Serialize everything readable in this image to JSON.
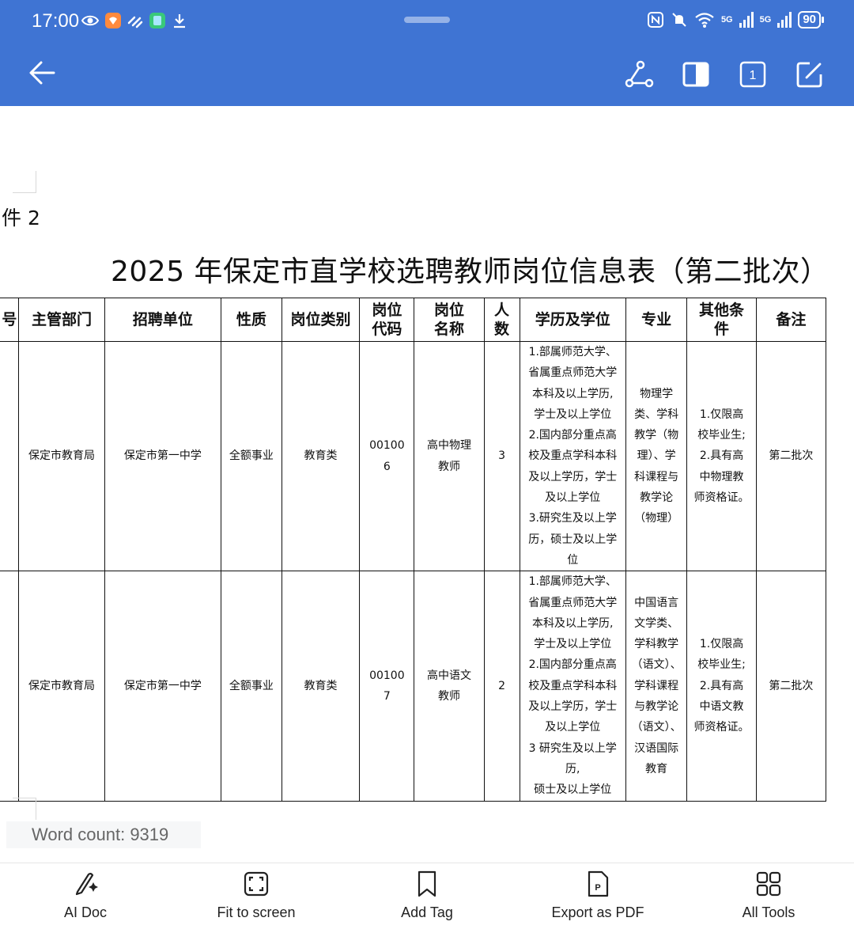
{
  "status_bar": {
    "time": "17:00",
    "battery": "90",
    "signal_1": "5G",
    "signal_2": "5G",
    "icons": [
      "eye-icon",
      "app-icon",
      "link-icon",
      "app-icon",
      "download-icon",
      "nfc-icon",
      "mute-icon",
      "wifi-icon",
      "signal-icon",
      "battery-icon"
    ]
  },
  "app_bar": {
    "actions": [
      "share-route-icon",
      "layout-icon",
      "page-count-icon",
      "edit-icon"
    ],
    "page_count": "1"
  },
  "document": {
    "attachment_label": "件 2",
    "title": "2025 年保定市直学校选聘教师岗位信息表（第二批次）",
    "table": {
      "headers": [
        "号",
        "主管部门",
        "招聘单位",
        "性质",
        "岗位类别",
        "岗位\n代码",
        "岗位\n名称",
        "人\n数",
        "学历及学位",
        "专业",
        "其他条\n件",
        "备注"
      ],
      "rows": [
        [
          "",
          "保定市教育局",
          "保定市第一中学",
          "全额事业",
          "教育类",
          "00100\n6",
          "高中物理\n教师",
          "3",
          "1.部属师范大学、\n省属重点师范大学\n本科及以上学历,\n学士及以上学位\n2.国内部分重点高\n校及重点学科本科\n及以上学历，学士\n及以上学位\n3.研究生及以上学\n历，硕士及以上学\n位",
          "物理学\n类、学科\n教学（物\n理）、学\n科课程与\n教学论\n（物理）",
          "1.仅限高\n校毕业生;\n2.具有高\n中物理教\n师资格证。",
          "第二批次"
        ],
        [
          "",
          "保定市教育局",
          "保定市第一中学",
          "全额事业",
          "教育类",
          "00100\n7",
          "高中语文\n教师",
          "2",
          "1.部属师范大学、\n省属重点师范大学\n本科及以上学历,\n学士及以上学位\n2.国内部分重点高\n校及重点学科本科\n及以上学历，学士\n及以上学位\n3 研究生及以上学历,\n硕士及以上学位",
          "中国语言\n文学类、\n学科教学\n（语文）、\n学科课程\n与教学论\n（语文）、\n汉语国际\n教育",
          "1.仅限高\n校毕业生;\n2.具有高\n中语文教\n师资格证。",
          "第二批次"
        ]
      ]
    },
    "word_count": "Word count: 9319"
  },
  "bottom_bar": {
    "tools": [
      {
        "label": "AI Doc",
        "icon": "ai-doc-icon"
      },
      {
        "label": "Fit to screen",
        "icon": "fit-screen-icon"
      },
      {
        "label": "Add Tag",
        "icon": "bookmark-icon"
      },
      {
        "label": "Export as PDF",
        "icon": "pdf-icon"
      },
      {
        "label": "All Tools",
        "icon": "grid-icon"
      }
    ]
  }
}
